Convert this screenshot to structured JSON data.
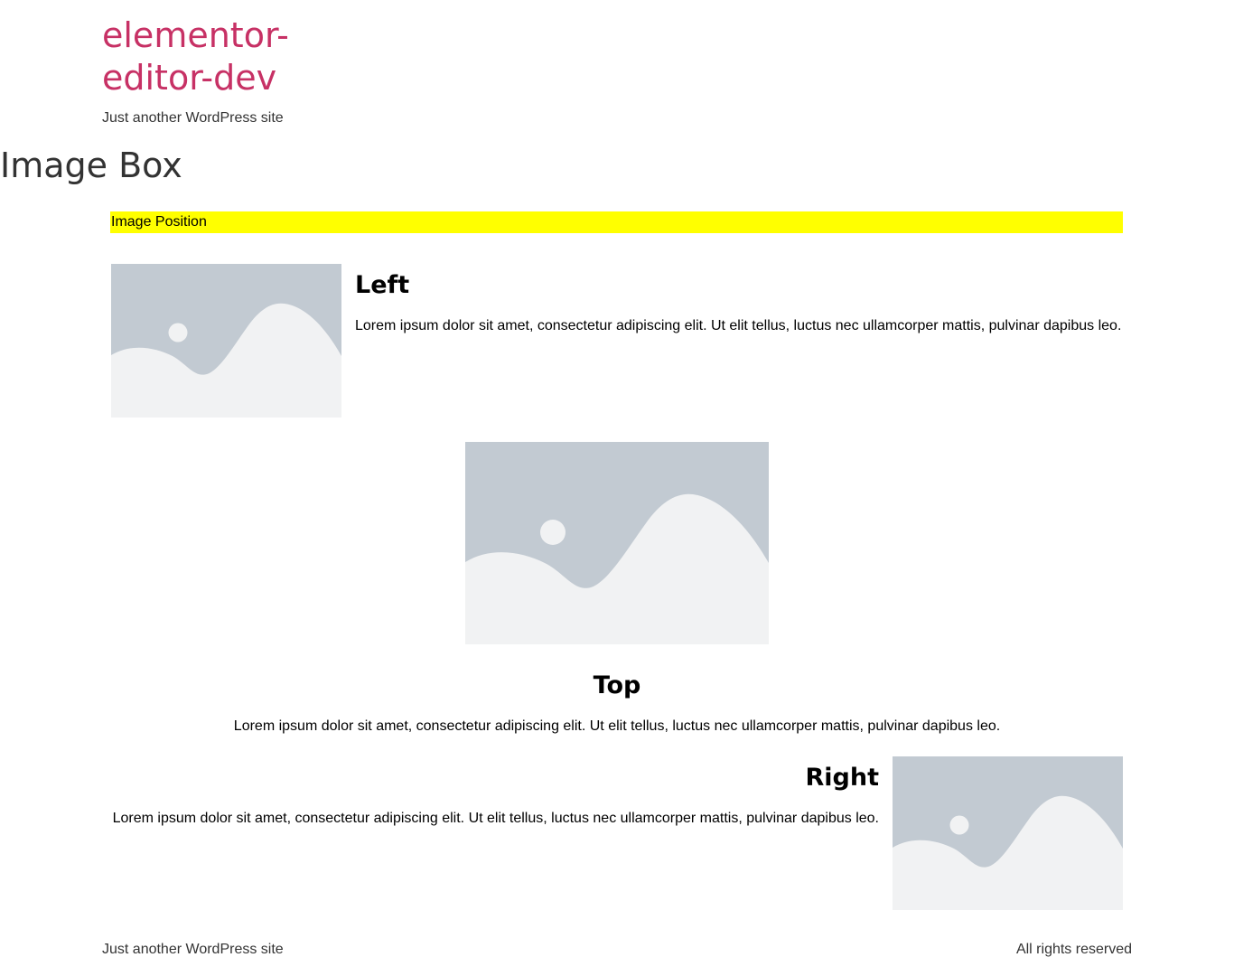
{
  "site": {
    "title": "elementor-editor-dev",
    "tagline": "Just another WordPress site"
  },
  "page": {
    "title": "Image Box",
    "section_heading": "Image Position"
  },
  "image_boxes": [
    {
      "position": "left",
      "image_icon": "image-placeholder-icon",
      "title": "Left",
      "description": "Lorem ipsum dolor sit amet, consectetur adipiscing elit. Ut elit tellus, luctus nec ullamcorper mattis, pulvinar dapibus leo."
    },
    {
      "position": "top",
      "image_icon": "image-placeholder-icon",
      "title": "Top",
      "description": "Lorem ipsum dolor sit amet, consectetur adipiscing elit. Ut elit tellus, luctus nec ullamcorper mattis, pulvinar dapibus leo."
    },
    {
      "position": "right",
      "image_icon": "image-placeholder-icon",
      "title": "Right",
      "description": "Lorem ipsum dolor sit amet, consectetur adipiscing elit. Ut elit tellus, luctus nec ullamcorper mattis, pulvinar dapibus leo."
    }
  ],
  "footer": {
    "left_text": "Just another WordPress site",
    "right_text": "All rights reserved"
  },
  "colors": {
    "site_title": "#c73165",
    "section_highlight": "#ffff00",
    "placeholder_bg": "#c2cad2",
    "placeholder_fg": "#f1f2f3"
  }
}
